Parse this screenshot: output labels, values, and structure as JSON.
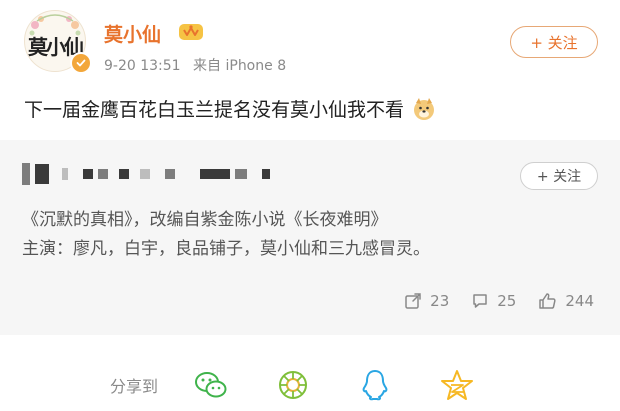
{
  "post": {
    "author": {
      "name": "莫小仙",
      "avatar_signature": "莫小仙",
      "avatar_icon": "brand-logo-avatar",
      "verified_icon": "verified-badge-icon",
      "vip_icon": "vip-crown-badge-icon"
    },
    "time": "9-20 13:51",
    "source": "来自 iPhone 8",
    "follow_label": "+ 关注",
    "content": "下一届金鹰百花白玉兰提名没有莫小仙我不看",
    "content_emoji": "doge-emoji-icon"
  },
  "repost": {
    "author_name_icon": "pixelated-name-icon",
    "follow_label": "+ 关注",
    "text_line1": "《沉默的真相》，改编自紫金陈小说《长夜难明》",
    "text_line2": "主演：廖凡，白宇，良品铺子，莫小仙和三九感冒灵。",
    "stats": {
      "reposts": "23",
      "comments": "25",
      "likes": "244"
    }
  },
  "share": {
    "label": "分享到",
    "targets": [
      {
        "name": "wechat-icon",
        "color": "#3fb34b"
      },
      {
        "name": "moments-icon",
        "color": "#7fbf3a"
      },
      {
        "name": "qq-icon",
        "color": "#2aa6e3"
      },
      {
        "name": "qzone-icon",
        "color": "#f6b824"
      }
    ]
  },
  "colors": {
    "accent": "#e8732d",
    "meta_gray": "#8a8a8a",
    "repost_bg": "#f6f6f6"
  }
}
